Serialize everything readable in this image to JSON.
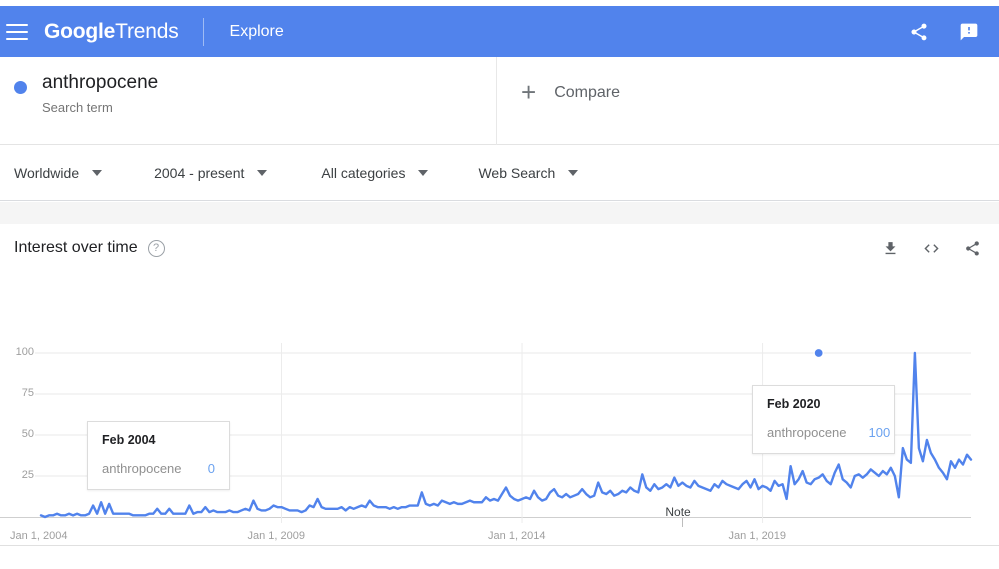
{
  "topbar": {
    "menu_icon": "hamburger-icon",
    "brand_bold": "Google",
    "brand_light": "Trends",
    "explore": "Explore",
    "share_icon": "share-icon",
    "feedback_icon": "feedback-icon"
  },
  "term": {
    "title": "anthropocene",
    "subtitle": "Search term",
    "dot_color": "#5183ec"
  },
  "compare": {
    "plus": "+",
    "label": "Compare"
  },
  "filters": [
    {
      "label": "Worldwide"
    },
    {
      "label": "2004 - present"
    },
    {
      "label": "All categories"
    },
    {
      "label": "Web Search"
    }
  ],
  "card": {
    "title": "Interest over time",
    "help_icon": "?",
    "download_icon": "download-icon",
    "embed_icon": "embed-icon",
    "share_icon": "share-icon"
  },
  "tooltips": [
    {
      "date": "Feb 2004",
      "term": "anthropocene",
      "value": "0"
    },
    {
      "date": "Feb 2020",
      "term": "anthropocene",
      "value": "100"
    }
  ],
  "annotation": {
    "label": "Note"
  },
  "chart_data": {
    "type": "line",
    "title": "Interest over time",
    "xlabel": "",
    "ylabel": "",
    "ylim": [
      0,
      100
    ],
    "grid": true,
    "legend": false,
    "line_color": "#5183ec",
    "ytick_labels": [
      "25",
      "50",
      "75",
      "100"
    ],
    "ytick_values": [
      25,
      50,
      75,
      100
    ],
    "xtick_labels": [
      "Jan 1, 2004",
      "Jan 1, 2009",
      "Jan 1, 2014",
      "Jan 1, 2019"
    ],
    "xtick_values": [
      0,
      60,
      120,
      180
    ],
    "x_unit": "months since Jan 2004",
    "series": [
      {
        "name": "anthropocene",
        "values": [
          1,
          0,
          1,
          1,
          2,
          1,
          1,
          2,
          1,
          2,
          1,
          1,
          2,
          7,
          2,
          9,
          2,
          8,
          2,
          2,
          2,
          2,
          2,
          1,
          1,
          1,
          1,
          2,
          2,
          5,
          2,
          2,
          5,
          2,
          2,
          2,
          2,
          7,
          2,
          3,
          3,
          6,
          3,
          4,
          3,
          3,
          3,
          4,
          3,
          3,
          4,
          5,
          4,
          10,
          5,
          4,
          4,
          5,
          7,
          6,
          6,
          5,
          4,
          4,
          4,
          3,
          4,
          7,
          6,
          11,
          6,
          5,
          5,
          5,
          5,
          6,
          4,
          6,
          5,
          6,
          7,
          6,
          10,
          7,
          6,
          6,
          6,
          5,
          6,
          5,
          6,
          6,
          7,
          7,
          7,
          15,
          8,
          7,
          8,
          7,
          10,
          9,
          8,
          9,
          8,
          8,
          9,
          10,
          9,
          9,
          9,
          12,
          10,
          11,
          10,
          14,
          18,
          13,
          11,
          10,
          11,
          12,
          11,
          16,
          12,
          10,
          11,
          15,
          17,
          13,
          12,
          14,
          12,
          13,
          14,
          17,
          14,
          12,
          13,
          21,
          15,
          14,
          16,
          13,
          14,
          16,
          15,
          18,
          16,
          15,
          26,
          18,
          16,
          20,
          17,
          18,
          20,
          18,
          24,
          19,
          21,
          19,
          18,
          22,
          19,
          18,
          17,
          16,
          20,
          18,
          22,
          20,
          19,
          18,
          17,
          20,
          22,
          18,
          23,
          17,
          19,
          18,
          16,
          22,
          19,
          20,
          11,
          31,
          20,
          23,
          28,
          21,
          20,
          23,
          24,
          26,
          22,
          20,
          27,
          32,
          23,
          21,
          18,
          25,
          26,
          24,
          26,
          29,
          27,
          25,
          28,
          26,
          30,
          25,
          12,
          42,
          35,
          33,
          100,
          42,
          34,
          47,
          39,
          35,
          30,
          27,
          23,
          34,
          30,
          35,
          32,
          38,
          35
        ],
        "highlight_points": [
          {
            "x_index": 1,
            "date": "Feb 2004",
            "value": 0
          },
          {
            "x_index": 194,
            "date": "Feb 2020",
            "value": 100
          }
        ]
      }
    ]
  }
}
